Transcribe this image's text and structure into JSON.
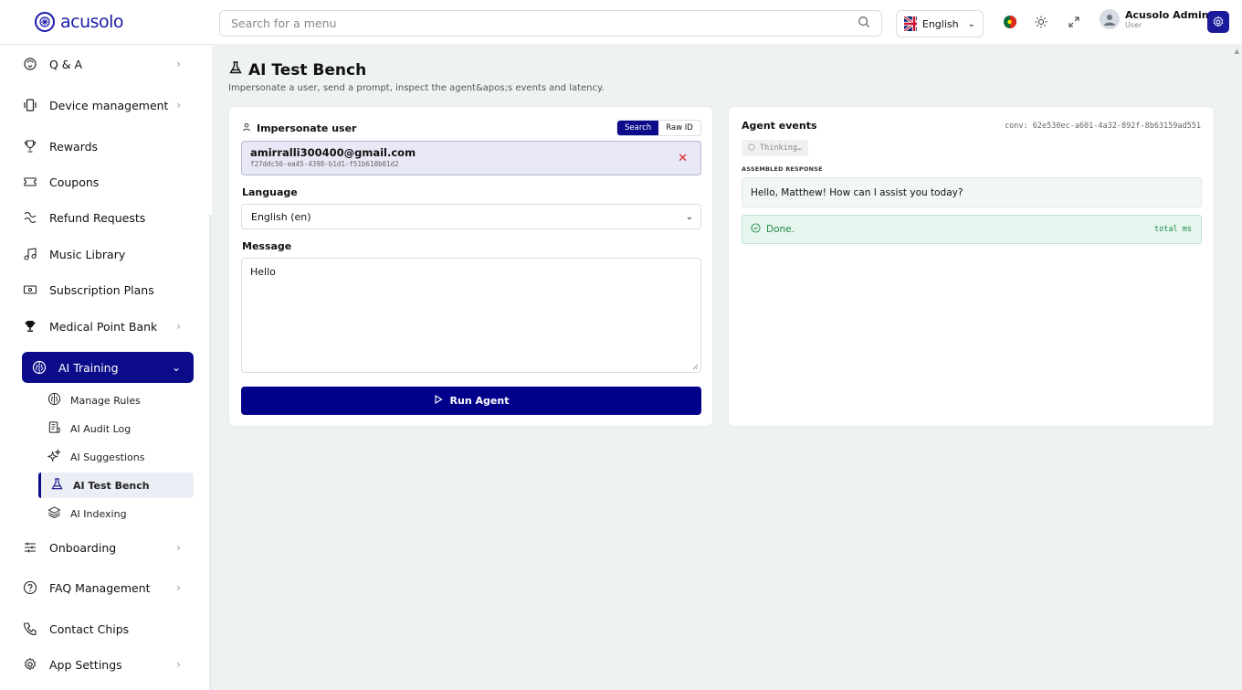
{
  "brand": {
    "name": "acusolo"
  },
  "topbar": {
    "search_placeholder": "Search for a menu",
    "language": "English",
    "user_name": "Acusolo Admin",
    "user_role": "User"
  },
  "sidebar": {
    "items": [
      {
        "label": "Q & A",
        "icon": "qa-icon",
        "chevron": true
      },
      {
        "label": "Device management",
        "icon": "device-icon",
        "chevron": true
      },
      {
        "label": "Rewards",
        "icon": "trophy-icon",
        "chevron": false
      },
      {
        "label": "Coupons",
        "icon": "ticket-icon",
        "chevron": false
      },
      {
        "label": "Refund Requests",
        "icon": "refund-icon",
        "chevron": false
      },
      {
        "label": "Music Library",
        "icon": "music-icon",
        "chevron": false
      },
      {
        "label": "Subscription Plans",
        "icon": "banknote-icon",
        "chevron": false
      },
      {
        "label": "Medical Point Bank",
        "icon": "trophy-solid-icon",
        "chevron": true
      },
      {
        "label": "AI Training",
        "icon": "brain-icon",
        "chevron": true,
        "active": true
      }
    ],
    "subitems": [
      {
        "label": "Manage Rules",
        "icon": "brain-icon"
      },
      {
        "label": "AI Audit Log",
        "icon": "log-icon"
      },
      {
        "label": "AI Suggestions",
        "icon": "sparkles-icon"
      },
      {
        "label": "AI Test Bench",
        "icon": "flask-icon",
        "active": true
      },
      {
        "label": "AI Indexing",
        "icon": "layers-icon"
      }
    ],
    "items_after": [
      {
        "label": "Onboarding",
        "icon": "sliders-icon",
        "chevron": true
      },
      {
        "label": "FAQ Management",
        "icon": "help-circle-icon",
        "chevron": true
      },
      {
        "label": "Contact Chips",
        "icon": "phone-icon",
        "chevron": false
      },
      {
        "label": "App Settings",
        "icon": "gear-icon",
        "chevron": true
      }
    ]
  },
  "page": {
    "title": "AI Test Bench",
    "subtitle": "Impersonate a user, send a prompt, inspect the agent&apos;s events and latency."
  },
  "left_card": {
    "impersonate_label": "Impersonate user",
    "mode_search": "Search",
    "mode_raw": "Raw ID",
    "selected_email": "amirralli300400@gmail.com",
    "selected_id": "f27ddc56-ea45-4398-b1d1-f51b610b01d2",
    "language_label": "Language",
    "language_value": "English (en)",
    "message_label": "Message",
    "message_value": "Hello",
    "run_label": "Run Agent"
  },
  "right_card": {
    "title": "Agent events",
    "conv": "conv: 62e530ec-a601-4a32-892f-8b63159ad551",
    "thinking": "Thinking…",
    "assembled_label": "ASSEMBLED RESPONSE",
    "response": "Hello, Matthew! How can I assist you today?",
    "done": "Done.",
    "total": "total ms"
  },
  "colors": {
    "primary": "#0c0c8a",
    "success": "#1f8a4c",
    "danger": "#e02424",
    "background": "#eef3f2"
  }
}
